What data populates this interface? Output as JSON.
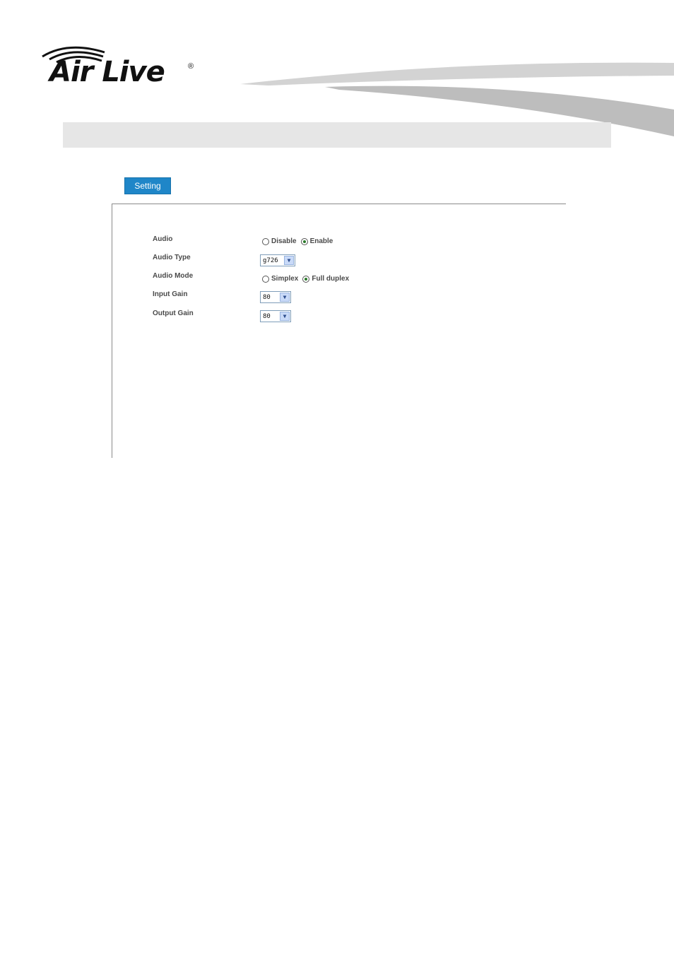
{
  "brand": {
    "logo_text": "Air Live",
    "registered_mark": "®"
  },
  "tabs": {
    "setting_label": "Setting"
  },
  "form": {
    "audio": {
      "label": "Audio",
      "options": [
        "Disable",
        "Enable"
      ],
      "selected": "Enable"
    },
    "audio_type": {
      "label": "Audio Type",
      "value": "g726"
    },
    "audio_mode": {
      "label": "Audio Mode",
      "options": [
        "Simplex",
        "Full duplex"
      ],
      "selected": "Full duplex"
    },
    "input_gain": {
      "label": "Input Gain",
      "value": "80"
    },
    "output_gain": {
      "label": "Output Gain",
      "value": "80"
    }
  },
  "icons": {
    "dropdown": "chevron-down-icon",
    "radio": "radio-icon"
  },
  "colors": {
    "accent": "#1f86c8",
    "title_bar": "#e6e6e6",
    "select_border": "#7f9db9"
  }
}
